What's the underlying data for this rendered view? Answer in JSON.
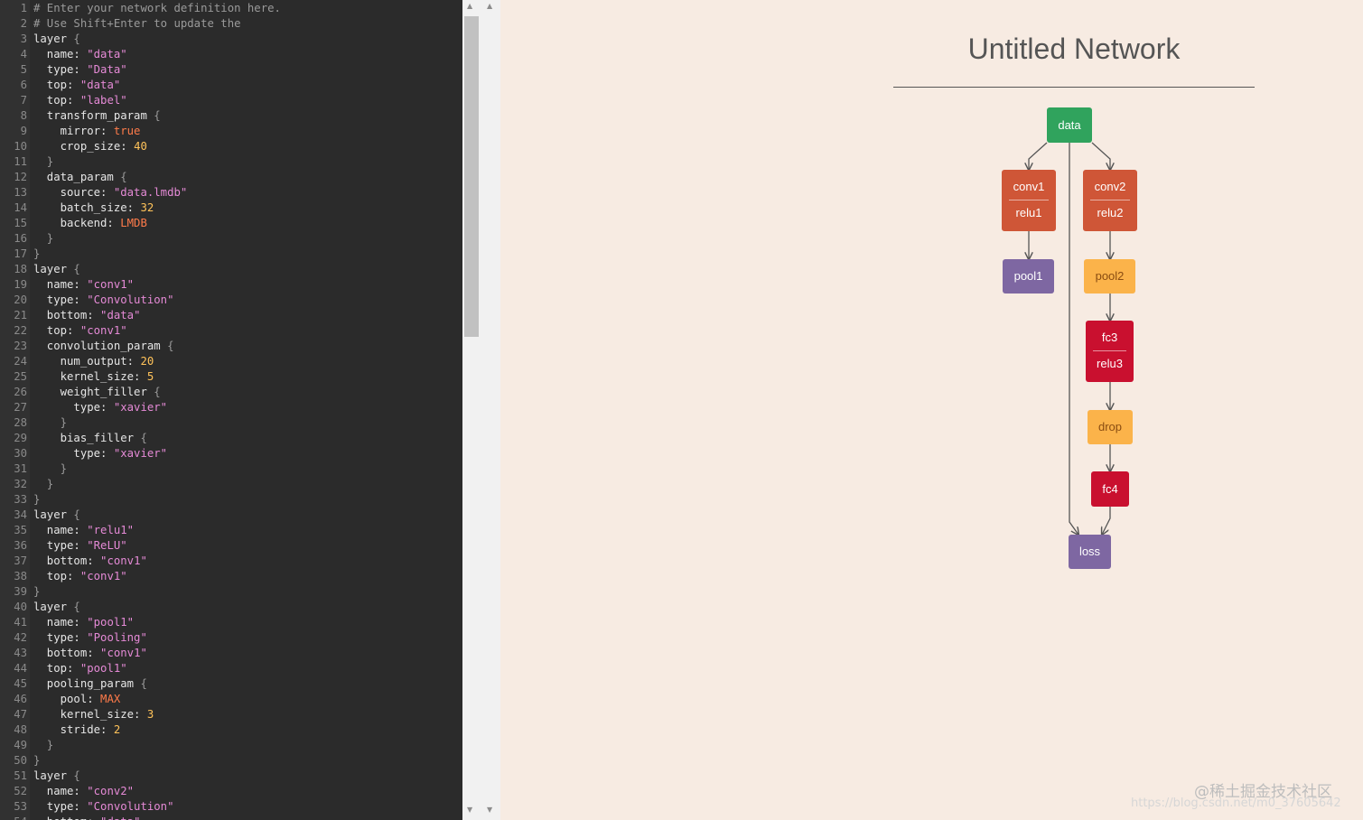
{
  "editor": {
    "lines": [
      [
        [
          "c",
          "# Enter your network definition here."
        ]
      ],
      [
        [
          "c",
          "# Use Shift+Enter to update the"
        ]
      ],
      [
        [
          "p",
          "layer "
        ],
        [
          "b",
          "{"
        ]
      ],
      [
        [
          "p",
          "  name: "
        ],
        [
          "s",
          "\"data\""
        ]
      ],
      [
        [
          "p",
          "  type: "
        ],
        [
          "s",
          "\"Data\""
        ]
      ],
      [
        [
          "p",
          "  top: "
        ],
        [
          "s",
          "\"data\""
        ]
      ],
      [
        [
          "p",
          "  top: "
        ],
        [
          "s",
          "\"label\""
        ]
      ],
      [
        [
          "p",
          "  transform_param "
        ],
        [
          "b",
          "{"
        ]
      ],
      [
        [
          "p",
          "    mirror: "
        ],
        [
          "k",
          "true"
        ]
      ],
      [
        [
          "p",
          "    crop_size: "
        ],
        [
          "n",
          "40"
        ]
      ],
      [
        [
          "b",
          "  }"
        ]
      ],
      [
        [
          "p",
          "  data_param "
        ],
        [
          "b",
          "{"
        ]
      ],
      [
        [
          "p",
          "    source: "
        ],
        [
          "s",
          "\"data.lmdb\""
        ]
      ],
      [
        [
          "p",
          "    batch_size: "
        ],
        [
          "n",
          "32"
        ]
      ],
      [
        [
          "p",
          "    backend: "
        ],
        [
          "k",
          "LMDB"
        ]
      ],
      [
        [
          "b",
          "  }"
        ]
      ],
      [
        [
          "b",
          "}"
        ]
      ],
      [
        [
          "p",
          "layer "
        ],
        [
          "b",
          "{"
        ]
      ],
      [
        [
          "p",
          "  name: "
        ],
        [
          "s",
          "\"conv1\""
        ]
      ],
      [
        [
          "p",
          "  type: "
        ],
        [
          "s",
          "\"Convolution\""
        ]
      ],
      [
        [
          "p",
          "  bottom: "
        ],
        [
          "s",
          "\"data\""
        ]
      ],
      [
        [
          "p",
          "  top: "
        ],
        [
          "s",
          "\"conv1\""
        ]
      ],
      [
        [
          "p",
          "  convolution_param "
        ],
        [
          "b",
          "{"
        ]
      ],
      [
        [
          "p",
          "    num_output: "
        ],
        [
          "n",
          "20"
        ]
      ],
      [
        [
          "p",
          "    kernel_size: "
        ],
        [
          "n",
          "5"
        ]
      ],
      [
        [
          "p",
          "    weight_filler "
        ],
        [
          "b",
          "{"
        ]
      ],
      [
        [
          "p",
          "      type: "
        ],
        [
          "s",
          "\"xavier\""
        ]
      ],
      [
        [
          "b",
          "    }"
        ]
      ],
      [
        [
          "p",
          "    bias_filler "
        ],
        [
          "b",
          "{"
        ]
      ],
      [
        [
          "p",
          "      type: "
        ],
        [
          "s",
          "\"xavier\""
        ]
      ],
      [
        [
          "b",
          "    }"
        ]
      ],
      [
        [
          "b",
          "  }"
        ]
      ],
      [
        [
          "b",
          "}"
        ]
      ],
      [
        [
          "p",
          "layer "
        ],
        [
          "b",
          "{"
        ]
      ],
      [
        [
          "p",
          "  name: "
        ],
        [
          "s",
          "\"relu1\""
        ]
      ],
      [
        [
          "p",
          "  type: "
        ],
        [
          "s",
          "\"ReLU\""
        ]
      ],
      [
        [
          "p",
          "  bottom: "
        ],
        [
          "s",
          "\"conv1\""
        ]
      ],
      [
        [
          "p",
          "  top: "
        ],
        [
          "s",
          "\"conv1\""
        ]
      ],
      [
        [
          "b",
          "}"
        ]
      ],
      [
        [
          "p",
          "layer "
        ],
        [
          "b",
          "{"
        ]
      ],
      [
        [
          "p",
          "  name: "
        ],
        [
          "s",
          "\"pool1\""
        ]
      ],
      [
        [
          "p",
          "  type: "
        ],
        [
          "s",
          "\"Pooling\""
        ]
      ],
      [
        [
          "p",
          "  bottom: "
        ],
        [
          "s",
          "\"conv1\""
        ]
      ],
      [
        [
          "p",
          "  top: "
        ],
        [
          "s",
          "\"pool1\""
        ]
      ],
      [
        [
          "p",
          "  pooling_param "
        ],
        [
          "b",
          "{"
        ]
      ],
      [
        [
          "p",
          "    pool: "
        ],
        [
          "k",
          "MAX"
        ]
      ],
      [
        [
          "p",
          "    kernel_size: "
        ],
        [
          "n",
          "3"
        ]
      ],
      [
        [
          "p",
          "    stride: "
        ],
        [
          "n",
          "2"
        ]
      ],
      [
        [
          "b",
          "  }"
        ]
      ],
      [
        [
          "b",
          "}"
        ]
      ],
      [
        [
          "p",
          "layer "
        ],
        [
          "b",
          "{"
        ]
      ],
      [
        [
          "p",
          "  name: "
        ],
        [
          "s",
          "\"conv2\""
        ]
      ],
      [
        [
          "p",
          "  type: "
        ],
        [
          "s",
          "\"Convolution\""
        ]
      ],
      [
        [
          "p",
          "  bottom: "
        ],
        [
          "s",
          "\"data\""
        ]
      ]
    ]
  },
  "viewer": {
    "title": "Untitled Network",
    "nodes": [
      {
        "id": "data",
        "labels": [
          "data"
        ],
        "color": "green"
      },
      {
        "id": "conv1",
        "labels": [
          "conv1",
          "relu1"
        ],
        "color": "orange"
      },
      {
        "id": "conv2",
        "labels": [
          "conv2",
          "relu2"
        ],
        "color": "orange"
      },
      {
        "id": "pool1",
        "labels": [
          "pool1"
        ],
        "color": "purple"
      },
      {
        "id": "pool2",
        "labels": [
          "pool2"
        ],
        "color": "yellow"
      },
      {
        "id": "fc3",
        "labels": [
          "fc3",
          "relu3"
        ],
        "color": "red"
      },
      {
        "id": "drop",
        "labels": [
          "drop"
        ],
        "color": "yellow"
      },
      {
        "id": "fc4",
        "labels": [
          "fc4"
        ],
        "color": "red"
      },
      {
        "id": "loss",
        "labels": [
          "loss"
        ],
        "color": "purple"
      }
    ],
    "edges": [
      [
        "data",
        "conv1"
      ],
      [
        "data",
        "conv2"
      ],
      [
        "data",
        "loss"
      ],
      [
        "conv1",
        "pool1"
      ],
      [
        "conv2",
        "pool2"
      ],
      [
        "pool2",
        "fc3"
      ],
      [
        "fc3",
        "drop"
      ],
      [
        "drop",
        "fc4"
      ],
      [
        "fc4",
        "loss"
      ]
    ]
  },
  "watermark": {
    "line1": "@稀土掘金技术社区",
    "line2": "https://blog.csdn.net/m0_37605642"
  }
}
